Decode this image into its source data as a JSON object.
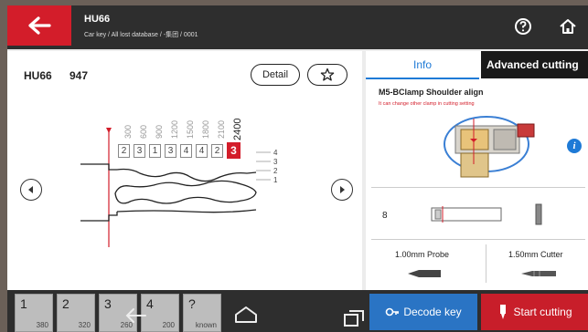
{
  "header": {
    "title": "HU66",
    "path": "Car key / All lost database / -集团 / 0001"
  },
  "key": {
    "model": "HU66",
    "number": "947",
    "detail_label": "Detail"
  },
  "depths": [
    "300",
    "600",
    "900",
    "1200",
    "1500",
    "1800",
    "2100",
    "2400"
  ],
  "cuts": [
    "2",
    "3",
    "1",
    "3",
    "4",
    "4",
    "2",
    "3"
  ],
  "steps": [
    "4",
    "3",
    "2",
    "1"
  ],
  "info_panel": {
    "tab_info": "Info",
    "tab_advanced": "Advanced cutting",
    "clamp_title": "M5-BClamp Shoulder align",
    "clamp_sub": "It can change other clamp in cutting setting",
    "quantity": "8",
    "probe": "1.00mm Probe",
    "cutter": "1.50mm Cutter"
  },
  "cut_tiles": [
    {
      "n": "1",
      "v": "380"
    },
    {
      "n": "2",
      "v": "320"
    },
    {
      "n": "3",
      "v": "260"
    },
    {
      "n": "4",
      "v": "200"
    },
    {
      "n": "?",
      "v": "known"
    }
  ],
  "actions": {
    "decode": "Decode key",
    "start": "Start cutting"
  },
  "colors": {
    "accent_red": "#d31d2a",
    "accent_blue": "#1e7ad6",
    "header_bg": "#2e2e2e"
  }
}
